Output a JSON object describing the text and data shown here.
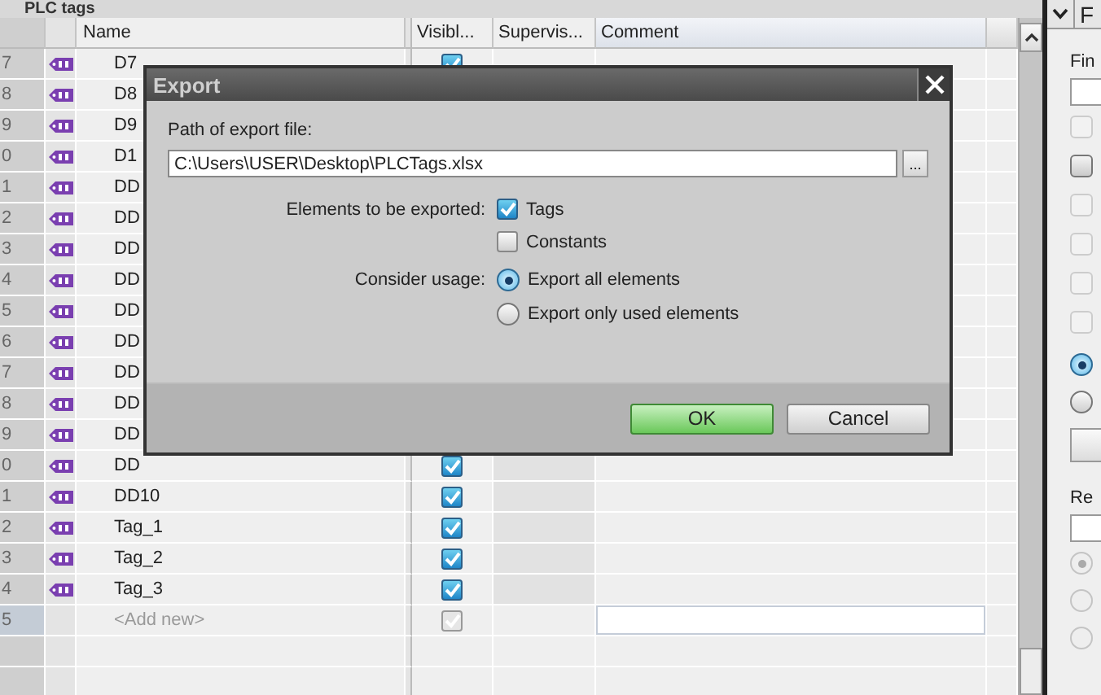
{
  "panel_title": "PLC tags",
  "table": {
    "columns": [
      "Name",
      "Visibl...",
      "Supervis...",
      "Comment"
    ],
    "rows": [
      {
        "number": "7",
        "kind": "tag",
        "name": "D7",
        "visible": true
      },
      {
        "number": "8",
        "kind": "tag",
        "name": "D8"
      },
      {
        "number": "9",
        "kind": "tag",
        "name": "D9"
      },
      {
        "number": "0",
        "kind": "tag",
        "name": "D1"
      },
      {
        "number": "1",
        "kind": "tag",
        "name": "DD"
      },
      {
        "number": "2",
        "kind": "tag",
        "name": "DD"
      },
      {
        "number": "3",
        "kind": "tag",
        "name": "DD"
      },
      {
        "number": "4",
        "kind": "tag",
        "name": "DD"
      },
      {
        "number": "5",
        "kind": "tag",
        "name": "DD"
      },
      {
        "number": "6",
        "kind": "tag",
        "name": "DD"
      },
      {
        "number": "7",
        "kind": "tag",
        "name": "DD"
      },
      {
        "number": "8",
        "kind": "tag",
        "name": "DD"
      },
      {
        "number": "9",
        "kind": "tag",
        "name": "DD"
      },
      {
        "number": "0",
        "kind": "tag",
        "name": "DD",
        "visible": true
      },
      {
        "number": "1",
        "kind": "tag",
        "name": "DD10",
        "visible": true
      },
      {
        "number": "2",
        "kind": "tag",
        "name": "Tag_1",
        "visible": true
      },
      {
        "number": "3",
        "kind": "tag",
        "name": "Tag_2",
        "visible": true
      },
      {
        "number": "4",
        "kind": "tag",
        "name": "Tag_3",
        "visible": true
      },
      {
        "number": "5",
        "kind": "add",
        "name": "<Add new>",
        "visible": true
      }
    ]
  },
  "dialog": {
    "title": "Export",
    "path_label": "Path of export file:",
    "path_value": "C:\\Users\\USER\\Desktop\\PLCTags.xlsx",
    "browse_label": "...",
    "elements_label": "Elements to be exported:",
    "elements": [
      {
        "label": "Tags",
        "checked": true
      },
      {
        "label": "Constants",
        "checked": false
      }
    ],
    "usage_label": "Consider usage:",
    "usage_options": [
      {
        "label": "Export all elements",
        "selected": true
      },
      {
        "label": "Export only used elements",
        "selected": false
      }
    ],
    "buttons": [
      {
        "label": "OK",
        "kind": "primary"
      },
      {
        "label": "Cancel",
        "kind": "secondary"
      }
    ]
  },
  "side_panel": {
    "title": "F",
    "find_label": "Fin",
    "options": [
      {
        "checked": false,
        "disabled": true
      },
      {
        "checked": false,
        "disabled": false
      },
      {
        "checked": false,
        "disabled": true
      },
      {
        "checked": false,
        "disabled": true
      },
      {
        "checked": false,
        "disabled": true
      },
      {
        "checked": false,
        "disabled": true
      }
    ],
    "direction": [
      {
        "selected": true
      },
      {
        "selected": false
      }
    ],
    "replace_label": "Re",
    "replace_options": [
      {
        "selected": true,
        "disabled": true
      },
      {
        "selected": false,
        "disabled": true
      },
      {
        "selected": false,
        "disabled": true
      }
    ]
  }
}
